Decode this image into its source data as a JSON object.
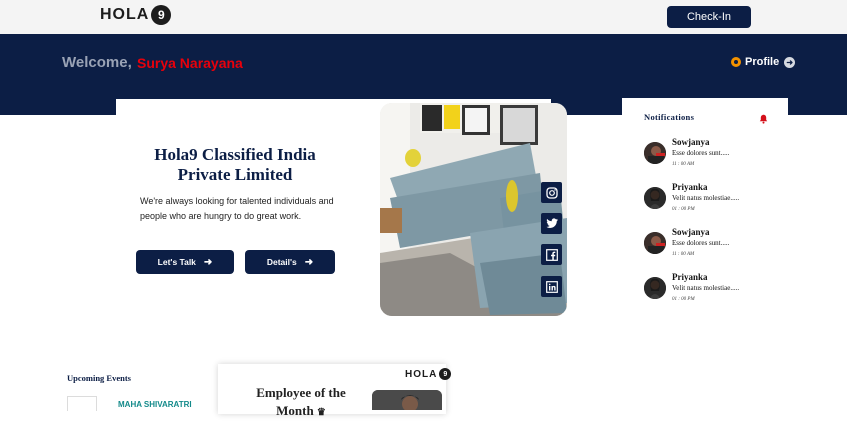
{
  "header": {
    "logo_text": "HOLA",
    "logo_badge": "9",
    "checkin_label": "Check-In"
  },
  "banner": {
    "welcome_label": "Welcome,",
    "user_name": "Surya Narayana",
    "profile_label": "Profile"
  },
  "company_card": {
    "title": "Hola9 Classified India Private Limited",
    "tagline": "We're always looking for talented individuals and people who are hungry to do great work.",
    "lets_talk_label": "Let's Talk",
    "details_label": "Detail's"
  },
  "social": [
    "instagram-icon",
    "twitter-icon",
    "facebook-icon",
    "linkedin-icon"
  ],
  "notifications": {
    "title": "Notifications",
    "items": [
      {
        "name": "Sowjanya",
        "message": "Esse dolores sunt.....",
        "time": "11 : 00 AM"
      },
      {
        "name": "Priyanka",
        "message": "Velit natus molestiae.....",
        "time": "01 : 00 PM"
      },
      {
        "name": "Sowjanya",
        "message": "Esse dolores sunt.....",
        "time": "11 : 00 AM"
      },
      {
        "name": "Priyanka",
        "message": "Velit natus molestiae.....",
        "time": "01 : 00 PM"
      }
    ]
  },
  "events": {
    "title": "Upcoming Events",
    "first_event": "MAHA SHIVARATRI"
  },
  "employee_card": {
    "title": "Employee of the Month",
    "logo_text": "HOLA",
    "logo_badge": "9"
  },
  "colors": {
    "navy": "#0c1e45",
    "accent_red": "#e8000b",
    "profile_orange": "#f39200",
    "event_teal": "#138a8a"
  }
}
